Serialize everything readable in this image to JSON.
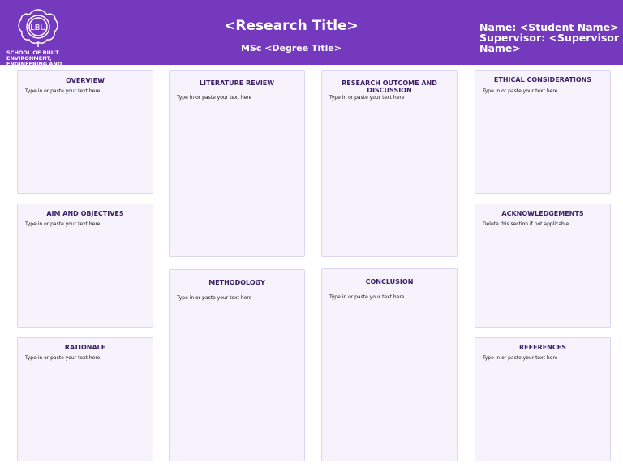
{
  "header": {
    "logo_text": "LBU",
    "school": "SCHOOL OF BUILT ENVIRONMENT, ENGINEERING AND",
    "title": "<Research Title>",
    "degree": "MSc <Degree Title>",
    "name": "Name: <Student Name>",
    "supervisor": "Supervisor: <Supervisor Name>"
  },
  "panels": [
    {
      "title": "OVERVIEW",
      "text": "Type in or paste your text here"
    },
    {
      "title": "AIM AND OBJECTIVES",
      "text": "Type in or paste your text here"
    },
    {
      "title": "RATIONALE",
      "text": "Type in or paste your text here"
    },
    {
      "title": "LITERATURE REVIEW",
      "text": "Type in or paste your text here"
    },
    {
      "title": "METHODOLOGY",
      "text": "Type in or paste your text here"
    },
    {
      "title": "RESEARCH OUTCOME AND DISCUSSION",
      "text": "Type in or paste your text here"
    },
    {
      "title": "CONCLUSION",
      "text": "Type in or paste your text here"
    },
    {
      "title": "ETHICAL CONSIDERATIONS",
      "text": "Type in or paste your text here"
    },
    {
      "title": "ACKNOWLEDGEMENTS",
      "text": "Delete this section if not applicable."
    },
    {
      "title": "REFERENCES",
      "text": "Type in or paste your text here"
    }
  ]
}
